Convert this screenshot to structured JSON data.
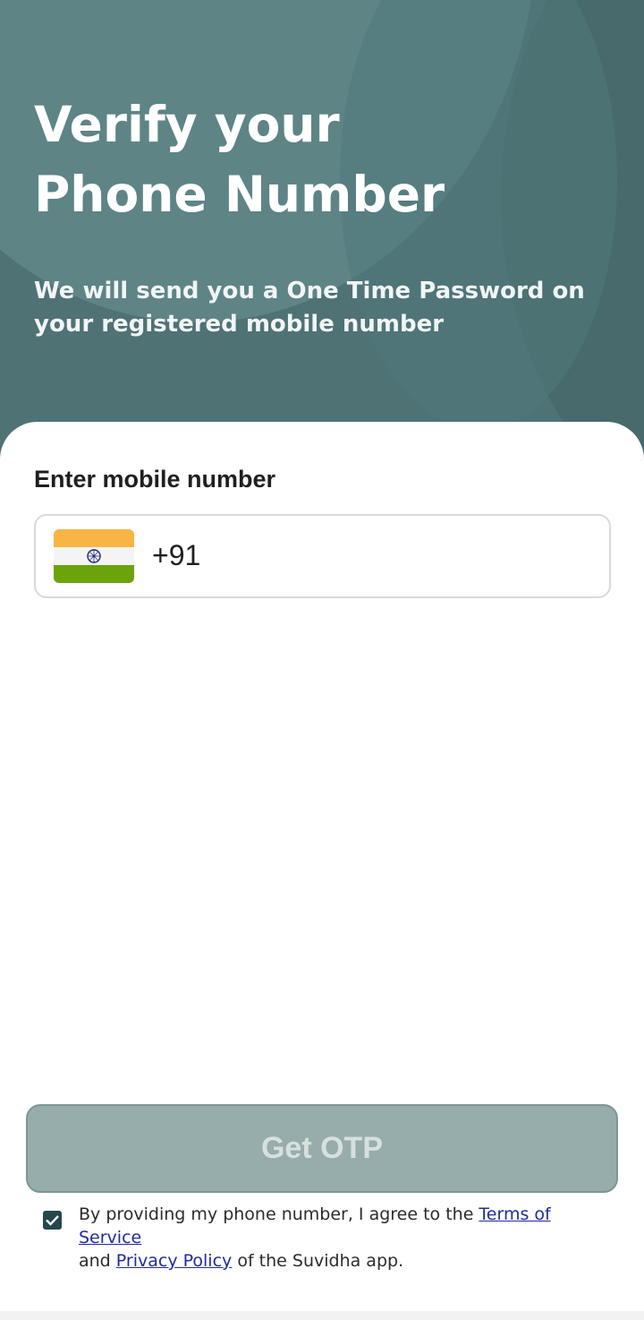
{
  "header": {
    "title_line1": "Verify your",
    "title_line2": "Phone Number",
    "subtitle": "We will send you a One Time Password on your registered mobile number"
  },
  "form": {
    "label": "Enter mobile number",
    "country_code": "+91",
    "flag_icon": "india-flag-icon"
  },
  "cta": {
    "label": "Get OTP"
  },
  "consent": {
    "checked": true,
    "text_before": "By providing my phone number, I agree to the ",
    "terms_link": "Terms of Service",
    "text_middle": "and ",
    "privacy_link": "Privacy Policy",
    "text_after": "  of the Suvidha app."
  },
  "colors": {
    "header_bg": "#4f7275",
    "cta_bg": "#97adac",
    "checkbox": "#26474c",
    "link": "#1f2aa0"
  }
}
